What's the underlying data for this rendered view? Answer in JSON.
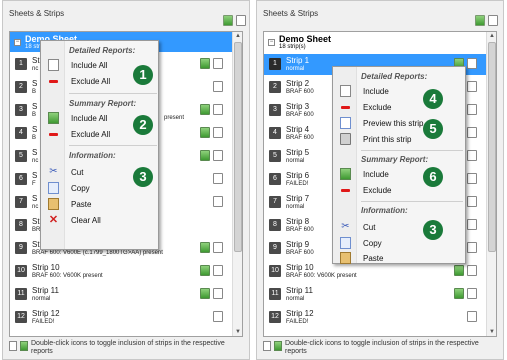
{
  "left_panel": {
    "title": "Sheets & Strips",
    "sheet": {
      "name": "Demo Sheet",
      "sub": "18 strip(s)"
    },
    "strips": [
      {
        "num": "1",
        "name": "St",
        "desc": "nc",
        "green": true,
        "page": true
      },
      {
        "num": "2",
        "name": "S",
        "desc": "B",
        "green": false,
        "page": true
      },
      {
        "num": "3",
        "name": "S",
        "desc": "B",
        "green": true,
        "page": true
      },
      {
        "num": "4",
        "name": "S",
        "desc": "B",
        "green": true,
        "page": true
      },
      {
        "num": "5",
        "name": "S",
        "desc": "nc",
        "green": true,
        "page": true
      },
      {
        "num": "6",
        "name": "S",
        "desc": "F",
        "green": false,
        "page": true
      },
      {
        "num": "7",
        "name": "S",
        "desc": "nc",
        "green": false,
        "page": true
      },
      {
        "num": "8",
        "name": "Strip 8",
        "desc": "BRAF 600: V600E (c.1799T>A) present",
        "green": false,
        "page": false
      },
      {
        "num": "9",
        "name": "Strip 9",
        "desc": "BRAF 600: V600E (c.1799_1800TG>AA) present",
        "green": true,
        "page": true
      },
      {
        "num": "10",
        "name": "Strip 10",
        "desc": "BRAF 600: V600K present",
        "green": true,
        "page": true
      },
      {
        "num": "11",
        "name": "Strip 11",
        "desc": "normal",
        "green": true,
        "page": true
      },
      {
        "num": "12",
        "name": "Strip 12",
        "desc": "FAILED!",
        "green": false,
        "page": true
      }
    ],
    "footer": "Double-click icons to toggle inclusion of strips in the respective reports",
    "partial_text": "present",
    "menu": {
      "detailed_title": "Detailed Reports:",
      "include_all": "Include All",
      "exclude_all": "Exclude All",
      "summary_title": "Summary Report:",
      "include_all_2": "Include All",
      "exclude_all_2": "Exclude All",
      "info_title": "Information:",
      "cut": "Cut",
      "copy": "Copy",
      "paste": "Paste",
      "clear_all": "Clear All"
    },
    "badges": [
      "1",
      "2",
      "3"
    ]
  },
  "right_panel": {
    "title": "Sheets & Strips",
    "sheet": {
      "name": "Demo Sheet",
      "sub": "18 strip(s)"
    },
    "strips": [
      {
        "num": "1",
        "name": "Strip 1",
        "desc": "normal",
        "green": true,
        "page": true
      },
      {
        "num": "2",
        "name": "Strip 2",
        "desc": "BRAF 600",
        "green": false,
        "page": true
      },
      {
        "num": "3",
        "name": "Strip 3",
        "desc": "BRAF 600",
        "green": false,
        "page": true
      },
      {
        "num": "4",
        "name": "Strip 4",
        "desc": "BRAF 600",
        "green": true,
        "page": true
      },
      {
        "num": "5",
        "name": "Strip 5",
        "desc": "normal",
        "green": false,
        "page": true
      },
      {
        "num": "6",
        "name": "Strip 6",
        "desc": "FAILED!",
        "green": false,
        "page": true
      },
      {
        "num": "7",
        "name": "Strip 7",
        "desc": "normal",
        "green": false,
        "page": true
      },
      {
        "num": "8",
        "name": "Strip 8",
        "desc": "BRAF 600",
        "green": false,
        "page": true
      },
      {
        "num": "9",
        "name": "Strip 9",
        "desc": "BRAF 600",
        "green": true,
        "page": true
      },
      {
        "num": "10",
        "name": "Strip 10",
        "desc": "BRAF 600: V600K present",
        "green": true,
        "page": true
      },
      {
        "num": "11",
        "name": "Strip 11",
        "desc": "normal",
        "green": true,
        "page": true
      },
      {
        "num": "12",
        "name": "Strip 12",
        "desc": "FAILED!",
        "green": false,
        "page": true
      }
    ],
    "footer": "Double-click icons to toggle inclusion of strips in the respective reports",
    "menu": {
      "detailed_title": "Detailed Reports:",
      "include": "Include",
      "exclude": "Exclude",
      "preview": "Preview this strip",
      "print": "Print this strip",
      "summary_title": "Summary Report:",
      "include_2": "Include",
      "exclude_2": "Exclude",
      "info_title": "Information:",
      "cut": "Cut",
      "copy": "Copy",
      "paste": "Paste"
    },
    "badges": [
      "4",
      "5",
      "6",
      "3"
    ]
  },
  "colors": {
    "selection": "#3399ff",
    "badge": "#1a7a3a",
    "exclude_red": "#e01818"
  }
}
